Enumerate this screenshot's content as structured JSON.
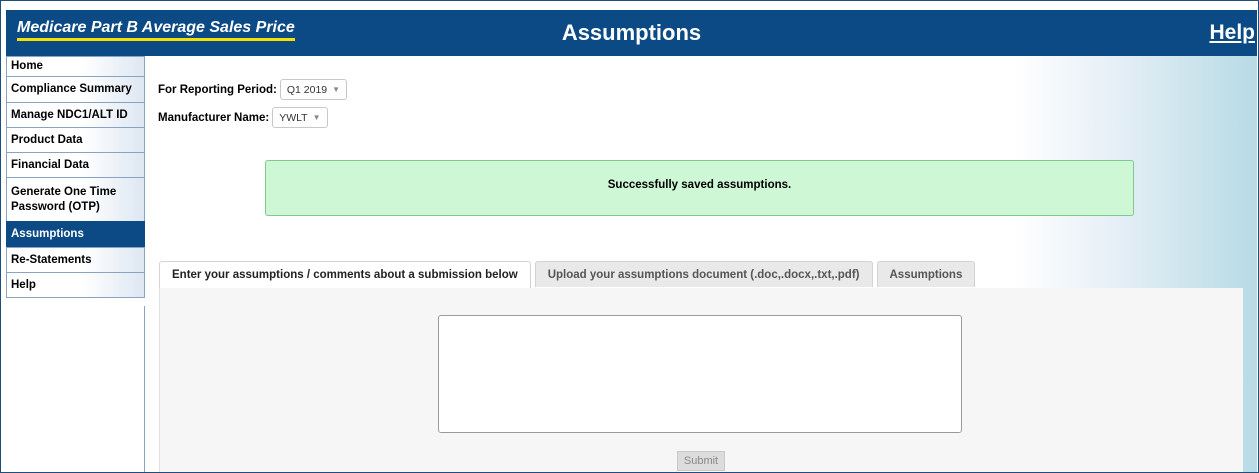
{
  "header": {
    "brand": "Medicare Part B Average Sales Price",
    "title": "Assumptions",
    "help_link": "Help"
  },
  "sidebar": {
    "items": [
      {
        "label": "Home"
      },
      {
        "label": "Compliance Summary"
      },
      {
        "label": "Manage NDC1/ALT ID"
      },
      {
        "label": "Product Data"
      },
      {
        "label": "Financial Data"
      },
      {
        "label": "Generate One Time Password (OTP)"
      },
      {
        "label": "Assumptions",
        "active": true
      },
      {
        "label": "Re-Statements"
      },
      {
        "label": "Help"
      }
    ]
  },
  "filters": {
    "reporting_period_label": "For Reporting Period:",
    "reporting_period_value": "Q1 2019",
    "manufacturer_label": "Manufacturer Name:",
    "manufacturer_value": "YWLT"
  },
  "alert": {
    "message": "Successfully saved assumptions."
  },
  "tabs": [
    {
      "label": "Enter your assumptions / comments about a submission below",
      "active": true
    },
    {
      "label": "Upload your assumptions document (.doc,.docx,.txt,.pdf)"
    },
    {
      "label": "Assumptions"
    }
  ],
  "form": {
    "comments_value": "",
    "submit_label": "Submit"
  },
  "colors": {
    "header_bg": "#0b4a85",
    "brand_underline": "#f7e000",
    "success_bg": "#cdf7d5",
    "active_nav_bg": "#0b4a85"
  }
}
